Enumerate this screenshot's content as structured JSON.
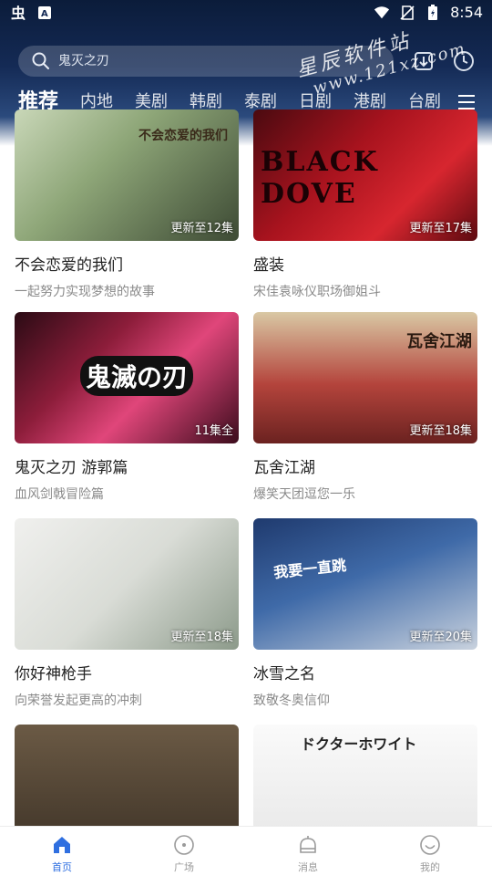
{
  "status_bar": {
    "time": "8:54",
    "icons": [
      "app-logo-icon",
      "notification-icon",
      "wifi-icon",
      "no-sim-icon",
      "battery-icon"
    ]
  },
  "search": {
    "placeholder": "鬼灭之刃"
  },
  "header_buttons": [
    "download-icon",
    "history-icon"
  ],
  "watermark": {
    "line1": "星辰软件站",
    "line2": "www.121xz.com"
  },
  "tabs": [
    {
      "label": "推荐",
      "active": true
    },
    {
      "label": "内地"
    },
    {
      "label": "美剧"
    },
    {
      "label": "韩剧"
    },
    {
      "label": "泰剧"
    },
    {
      "label": "日剧"
    },
    {
      "label": "港剧"
    },
    {
      "label": "台剧"
    }
  ],
  "cards": [
    {
      "title": "不会恋爱的我们",
      "subtitle": "一起努力实现梦想的故事",
      "badge": "更新至12集",
      "art_text": "不会恋爱的我们"
    },
    {
      "title": "盛装",
      "subtitle": "宋佳袁咏仪职场御姐斗",
      "badge": "更新至17集",
      "art_text": "BLACK DOVE"
    },
    {
      "title": "鬼灭之刃 游郭篇",
      "subtitle": "血风剑戟冒险篇",
      "badge": "11集全",
      "art_text": "鬼滅の刃"
    },
    {
      "title": "瓦舍江湖",
      "subtitle": "爆笑天团逗您一乐",
      "badge": "更新至18集",
      "art_text": "瓦舍江湖"
    },
    {
      "title": "你好神枪手",
      "subtitle": "向荣誉发起更高的冲刺",
      "badge": "更新至18集",
      "art_text": ""
    },
    {
      "title": "冰雪之名",
      "subtitle": "致敬冬奥信仰",
      "badge": "更新至20集",
      "art_text": "我要一直跳"
    },
    {
      "title": "",
      "subtitle": "",
      "badge": "",
      "art_text": ""
    },
    {
      "title": "",
      "subtitle": "",
      "badge": "",
      "art_text": "ドクターホワイト"
    }
  ],
  "bottom_nav": [
    {
      "label": "首页",
      "icon": "home-icon",
      "active": true
    },
    {
      "label": "广场",
      "icon": "plaza-icon"
    },
    {
      "label": "消息",
      "icon": "message-icon"
    },
    {
      "label": "我的",
      "icon": "profile-icon"
    }
  ],
  "colors": {
    "accent": "#2f6fe0",
    "header_dark": "#0b1c3a",
    "subtitle_gray": "#8a8a8a"
  }
}
